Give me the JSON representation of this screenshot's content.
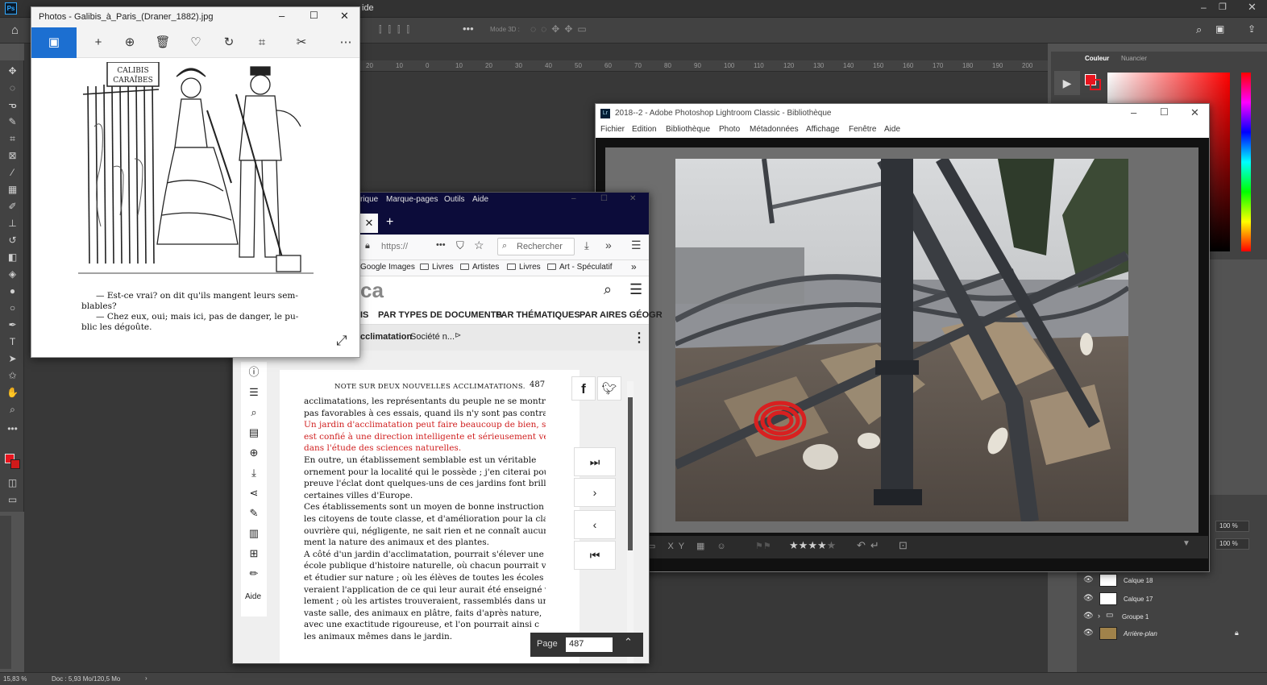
{
  "photoshop": {
    "menu_right_fragment": "ide",
    "options_bar": {
      "mode3d": "Mode 3D :"
    },
    "ruler_ticks": [
      "20",
      "10",
      "0",
      "10",
      "20",
      "30",
      "40",
      "50",
      "60",
      "70",
      "80",
      "90",
      "100",
      "110",
      "120",
      "130",
      "140",
      "150",
      "160",
      "170",
      "180",
      "190",
      "200"
    ],
    "status": {
      "zoom": "15,83 %",
      "doc": "Doc : 5,93 Mo/120,5 Mo"
    },
    "color_panel": {
      "tab_color": "Couleur",
      "tab_swatches": "Nuancier",
      "fg_color": "#e8141e"
    },
    "layers": {
      "opacity": "100 %",
      "fill": "100 %",
      "items": [
        {
          "name": "Calque 18"
        },
        {
          "name": "Calque 17"
        },
        {
          "name": "Groupe 1"
        },
        {
          "name": "Arrière-plan"
        }
      ]
    }
  },
  "photos_app": {
    "title": "Photos - Galibis_à_Paris_(Draner_1882).jpg",
    "caption_line1": "— Est-ce vrai? on dit qu'ils mangent leurs sem-",
    "caption_line2": "blables?",
    "caption_line3": "— Chez eux, oui; mais ici, pas de danger, le pu-",
    "caption_line4": "blic les dégoûte.",
    "sign_line1": "CALIBIS",
    "sign_line2": "CARAÏBES"
  },
  "lightroom": {
    "title": "2018--2 - Adobe Photoshop Lightroom Classic - Bibliothèque",
    "logo": "Lr",
    "menu": [
      "Fichier",
      "Edition",
      "Bibliothèque",
      "Photo",
      "Métadonnées",
      "Affichage",
      "Fenêtre",
      "Aide"
    ],
    "rating_stars": "★★★★★",
    "rating": 4
  },
  "firefox": {
    "menu": [
      "rique",
      "Marque-pages",
      "Outils",
      "Aide"
    ],
    "url": "https://",
    "search_placeholder": "Rechercher",
    "bookmarks": [
      "Google Images",
      "Livres",
      "Artistes",
      "Livres",
      "Art - Spéculatif"
    ],
    "site_logo": "ca",
    "nav_items": [
      "IS",
      "PAR TYPES DE DOCUMENTS",
      "PAR THÉMATIQUES",
      "PAR AIRES GÉOGR"
    ],
    "doc_title_bold": "cclimatation",
    "doc_title_rest": " Société n...",
    "aide": "Aide",
    "page_label": "Page",
    "page_value": "487",
    "page_header_title": "NOTE SUR DEUX NOUVELLES ACCLIMATATIONS.",
    "page_header_num": "487",
    "page_lines": [
      {
        "t": "acclimatations, les représentants du peuple ne se montrent",
        "red": false
      },
      {
        "t": "pas favorables à ces essais, quand ils n'y sont pas contraires.",
        "red": false
      },
      {
        "t": "  Un jardin d'acclimatation peut faire beaucoup de bien, s'il",
        "red": true
      },
      {
        "t": "est confié à une direction intelligente et sérieusement versée",
        "red": true
      },
      {
        "t": "dans l'étude des sciences naturelles.",
        "red": true
      },
      {
        "t": "  En outre, un établissement semblable est un véritable",
        "red": false
      },
      {
        "t": "ornement pour la localité qui le possède ; j'en citerai pour",
        "red": false
      },
      {
        "t": "preuve l'éclat dont quelques-uns de ces jardins font briller",
        "red": false
      },
      {
        "t": "certaines villes d'Europe.",
        "red": false
      },
      {
        "t": "  Ces établissements sont un moyen de bonne instruction pour",
        "red": false
      },
      {
        "t": "les citoyens de toute classe, et d'amélioration pour la classe",
        "red": false
      },
      {
        "t": "ouvrière qui, négligente, ne sait rien et ne connaît aucune-",
        "red": false
      },
      {
        "t": "ment la nature des animaux et des plantes.",
        "red": false
      },
      {
        "t": "  A côté d'un jardin d'acclimatation, pourrait s'élever une",
        "red": false
      },
      {
        "t": "école publique d'histoire naturelle, où chacun pourrait voir",
        "red": false
      },
      {
        "t": "et étudier sur nature ; où les élèves de toutes les écoles trou-",
        "red": false
      },
      {
        "t": "veraient l'application de ce qui leur aurait été enseigné verba-",
        "red": false
      },
      {
        "t": "lement ; où les artistes trouveraient, rassemblés dans une",
        "red": false
      },
      {
        "t": "vaste salle, des animaux en plâtre, faits d'après nature,",
        "red": false
      },
      {
        "t": "avec une exactitude rigoureuse, et l'on pourrait ainsi c",
        "red": false
      },
      {
        "t": "les animaux mêmes dans le jardin.",
        "red": false
      }
    ]
  }
}
